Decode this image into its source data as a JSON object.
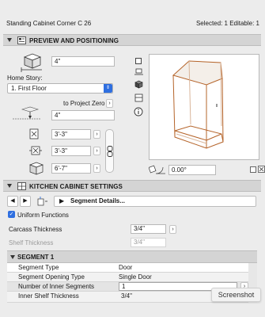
{
  "window": {
    "title": "Standing Cabinet Corner C 26",
    "selection_info": "Selected: 1 Editable: 1"
  },
  "preview_section": {
    "title": "PREVIEW AND POSITIONING",
    "top_offset": "4\"",
    "home_story_label": "Home Story:",
    "home_story_value": "1. First Floor",
    "to_project_zero_label": "to Project Zero",
    "elevation_value": "4\"",
    "width_value": "3'-3\"",
    "depth_value": "3'-3\"",
    "height_value": "6'-7\"",
    "rotation_value": "0.00°"
  },
  "kitchen_section": {
    "title": "KITCHEN CABINET SETTINGS",
    "segment_dropdown": "Segment Details...",
    "uniform_functions_label": "Uniform Functions",
    "uniform_functions_checked": true,
    "carcass_label": "Carcass Thickness",
    "carcass_value": "3/4\"",
    "shelf_label": "Shelf Thickness",
    "shelf_value": "3/4\""
  },
  "segment": {
    "title": "SEGMENT 1",
    "rows": [
      {
        "label": "Segment Type",
        "value": "Door"
      },
      {
        "label": "Segment Opening Type",
        "value": "Single Door"
      },
      {
        "label": "Number of Inner Segments",
        "value": "1"
      },
      {
        "label": "Inner Shelf Thickness",
        "value": "3/4\""
      }
    ]
  },
  "tooltip": "Screenshot",
  "colors": {
    "accent": "#2f6fe0",
    "panel_bg": "#ececec",
    "header_bg": "#d4d4d4",
    "cabinet_edge": "#b5642a"
  },
  "icons": [
    "settings-panel-icon",
    "cabinet-3d-icon",
    "elevation-icon",
    "width-icon",
    "depth-icon",
    "height-icon",
    "link-chain-icon",
    "rotation-icon",
    "info-icon",
    "kitchen-settings-icon",
    "move-segment-icon"
  ]
}
